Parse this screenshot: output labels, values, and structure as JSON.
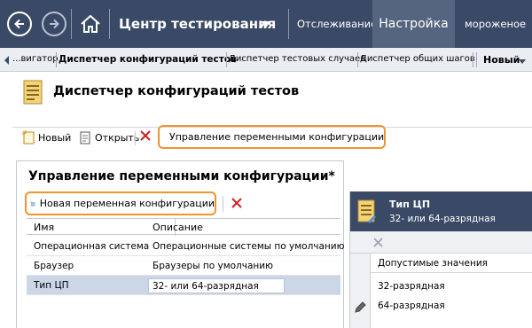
{
  "topbar": {
    "hub_title": "Центр тестирования",
    "tabs": [
      {
        "label": "Отслеживание"
      },
      {
        "label": "Настройка",
        "active": true
      },
      {
        "label": "мороженое"
      }
    ],
    "bg_color": "#3a4a66",
    "active_tab_color": "#55657f"
  },
  "breadcrumb": {
    "items": [
      "...вигатор",
      "Диспетчер конфигураций тестов",
      "Диспетчер тестовых случаев",
      "Диспетчер общих шагов"
    ],
    "new_label": "Новый"
  },
  "page": {
    "title": "Диспетчер конфигураций тестов"
  },
  "toolbar": {
    "new_label": "Новый",
    "open_label": "Открыть",
    "manage_label": "Управление переменными конфигурации",
    "highlight_color": "#ee9430"
  },
  "panel": {
    "title": "Управление переменными конфигурации*",
    "new_variable_label": "Новая переменная конфигурации",
    "columns": [
      "Имя",
      "Описание"
    ],
    "rows": [
      {
        "name": "Операционная система",
        "description": "Операционные системы по умолчанию"
      },
      {
        "name": "Браузер",
        "description": "Браузеры по умолчанию"
      },
      {
        "name": "Тип ЦП",
        "description": "32- или 64-разрядная",
        "selected": true
      }
    ]
  },
  "detail": {
    "title": "Тип ЦП",
    "subtitle": "32- или 64-разрядная",
    "column_header": "Допустимые значения",
    "values": [
      "32-разрядная",
      "64-разрядная"
    ]
  }
}
